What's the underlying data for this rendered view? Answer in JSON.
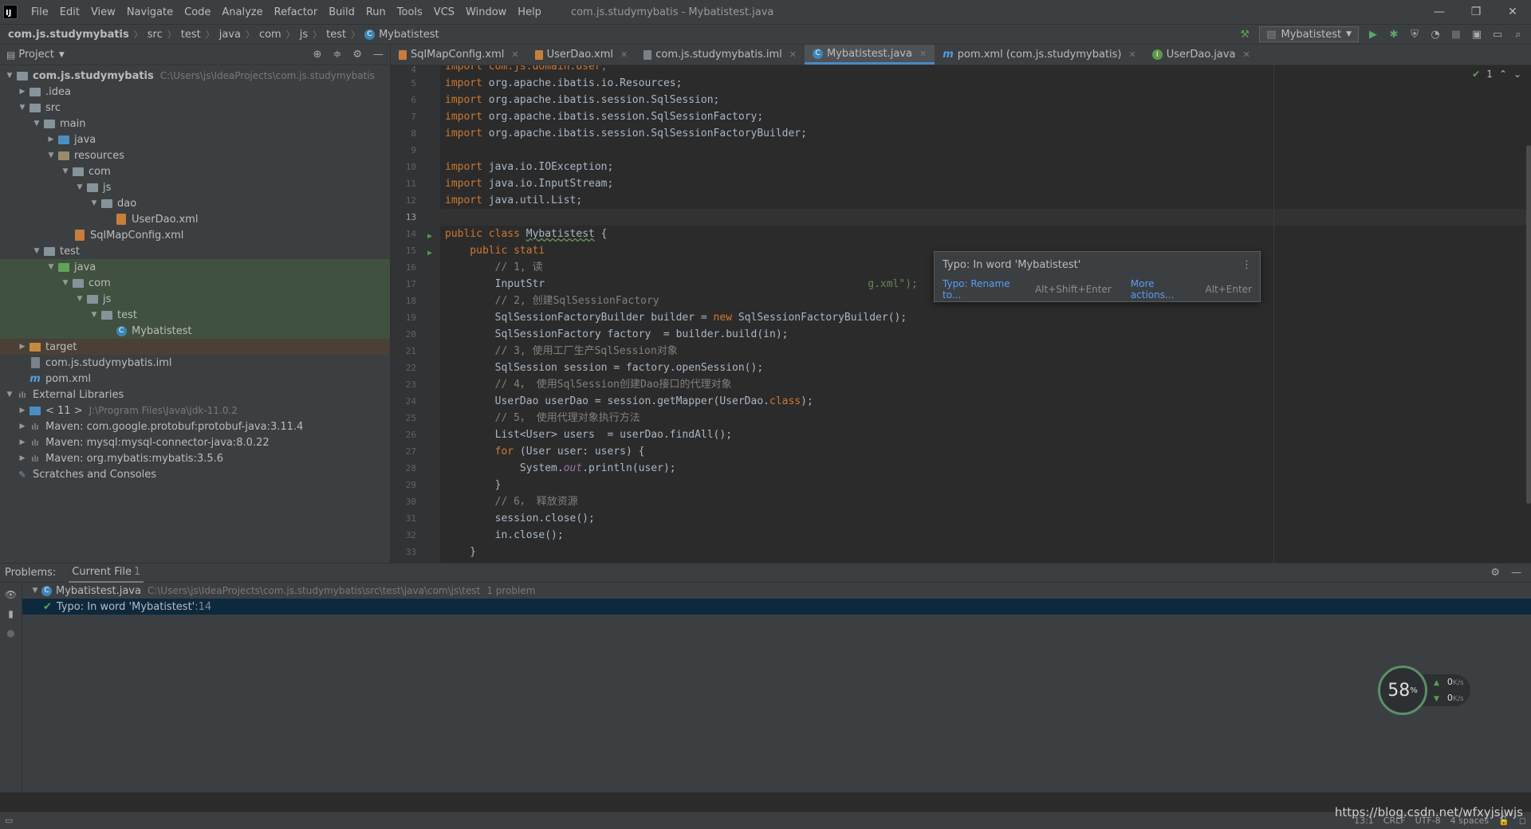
{
  "menubar": {
    "logo": "IJ",
    "items": [
      "File",
      "Edit",
      "View",
      "Navigate",
      "Code",
      "Analyze",
      "Refactor",
      "Build",
      "Run",
      "Tools",
      "VCS",
      "Window",
      "Help"
    ],
    "window_title": "com.js.studymybatis - Mybatistest.java",
    "controls": [
      "—",
      "❐",
      "✕"
    ]
  },
  "navbar": {
    "crumbs": [
      "com.js.studymybatis",
      "src",
      "test",
      "java",
      "com",
      "js",
      "test",
      "Mybatistest"
    ],
    "run_config": "Mybatistest"
  },
  "project": {
    "title": "Project",
    "tree": [
      {
        "label": "com.js.studymybatis",
        "hint": "C:\\Users\\js\\IdeaProjects\\com.js.studymybatis"
      },
      {
        "label": ".idea"
      },
      {
        "label": "src"
      },
      {
        "label": "main"
      },
      {
        "label": "java"
      },
      {
        "label": "resources"
      },
      {
        "label": "com"
      },
      {
        "label": "js"
      },
      {
        "label": "dao"
      },
      {
        "label": "UserDao.xml"
      },
      {
        "label": "SqlMapConfig.xml"
      },
      {
        "label": "test"
      },
      {
        "label": "java"
      },
      {
        "label": "com"
      },
      {
        "label": "js"
      },
      {
        "label": "test"
      },
      {
        "label": "Mybatistest"
      },
      {
        "label": "target"
      },
      {
        "label": "com.js.studymybatis.iml"
      },
      {
        "label": "pom.xml"
      },
      {
        "label": "External Libraries"
      },
      {
        "label": "< 11 >",
        "hint": "J:\\Program Files\\Java\\jdk-11.0.2"
      },
      {
        "label": "Maven: com.google.protobuf:protobuf-java:3.11.4"
      },
      {
        "label": "Maven: mysql:mysql-connector-java:8.0.22"
      },
      {
        "label": "Maven: org.mybatis:mybatis:3.5.6"
      },
      {
        "label": "Scratches and Consoles"
      }
    ]
  },
  "tabs": [
    {
      "label": "SqlMapConfig.xml"
    },
    {
      "label": "UserDao.xml"
    },
    {
      "label": "com.js.studymybatis.iml"
    },
    {
      "label": "Mybatistest.java"
    },
    {
      "label": "pom.xml (com.js.studymybatis)"
    },
    {
      "label": "UserDao.java"
    }
  ],
  "editor": {
    "status_count": "1",
    "line_numbers": [
      "4",
      "5",
      "6",
      "7",
      "8",
      "9",
      "10",
      "11",
      "12",
      "13",
      "14",
      "15",
      "16",
      "17",
      "18",
      "19",
      "20",
      "21",
      "22",
      "23",
      "24",
      "25",
      "26",
      "27",
      "28",
      "29",
      "30",
      "31",
      "32",
      "33"
    ],
    "code": {
      "l4": "import com.js.domain.User;",
      "l5a": "import ",
      "l5b": "org.apache.ibatis.io.Resources;",
      "l6a": "import ",
      "l6b": "org.apache.ibatis.session.SqlSession;",
      "l7a": "import ",
      "l7b": "org.apache.ibatis.session.SqlSessionFactory;",
      "l8a": "import ",
      "l8b": "org.apache.ibatis.session.SqlSessionFactoryBuilder;",
      "l10a": "import ",
      "l10b": "java.io.IOException;",
      "l11a": "import ",
      "l11b": "java.io.InputStream;",
      "l12a": "import ",
      "l12b": "java.util.List;",
      "l14a": "public class ",
      "l14b": "Mybatistest",
      "l14c": " {",
      "l15a": "    public stati",
      "l16a": "        // 1, 读",
      "l17a": "        InputStr",
      "l17b": "g.xml\");",
      "l18": "        // 2, 创建SqlSessionFactory",
      "l19a": "        SqlSessionFactoryBuilder builder = ",
      "l19b": "new",
      "l19c": " SqlSessionFactoryBuilder();",
      "l20": "        SqlSessionFactory factory  = builder.build(in);",
      "l21": "        // 3, 使用工厂生产SqlSession对象",
      "l22": "        SqlSession session = factory.openSession();",
      "l23": "        // 4， 使用SqlSession创建Dao接口的代理对象",
      "l24a": "        UserDao userDao = session.getMapper(UserDao.",
      "l24b": "class",
      "l24c": ");",
      "l25": "        // 5， 使用代理对象执行方法",
      "l26": "        List<User> users  = userDao.findAll();",
      "l27a": "        ",
      "l27b": "for",
      "l27c": " (User user: users) {",
      "l28a": "            System.",
      "l28b": "out",
      "l28c": ".println(user);",
      "l29": "        }",
      "l30": "        // 6， 释放资源",
      "l31": "        session.close();",
      "l32": "        in.close();",
      "l33": "    }"
    }
  },
  "popup": {
    "title": "Typo: In word 'Mybatistest'",
    "action1": "Typo: Rename to...",
    "shortcut1": "Alt+Shift+Enter",
    "action2": "More actions...",
    "shortcut2": "Alt+Enter"
  },
  "problems": {
    "title": "Problems:",
    "tab": "Current File",
    "tab_count": "1",
    "file": "Mybatistest.java",
    "file_path": "C:\\Users\\js\\IdeaProjects\\com.js.studymybatis\\src\\test\\java\\com\\js\\test",
    "file_count": "1 problem",
    "item": "Typo: In word 'Mybatistest'",
    "item_line": ":14"
  },
  "gauge": {
    "percent": "58",
    "percent_unit": "%",
    "up": "0",
    "down": "0",
    "unit": "K/s"
  },
  "statusbar": {
    "position": "13:1",
    "line_sep": "CRLF",
    "encoding": "UTF-8",
    "indent": "4 spaces"
  },
  "watermark": "https://blog.csdn.net/wfxyjsjwjs"
}
